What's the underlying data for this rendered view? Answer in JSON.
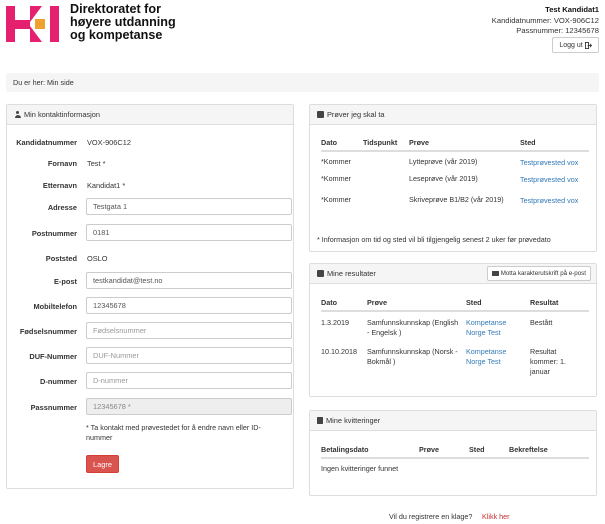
{
  "org": {
    "name_line1": "Direktoratet for",
    "name_line2": "høyere utdanning",
    "name_line3": "og kompetanse"
  },
  "user": {
    "name": "Test Kandidat1",
    "candidate_number": "Kandidatnummer: VOX-906C12",
    "passport_number": "Passnummer: 12345678",
    "logout_label": "Logg ut",
    "logout_icon": "sign-out-icon"
  },
  "breadcrumb": "Du er her: Min side",
  "contact": {
    "heading": "Min kontaktinformasjon",
    "labels": {
      "candidate": "Kandidatnummer",
      "firstname": "Fornavn",
      "lastname": "Etternavn",
      "address": "Adresse",
      "postcode": "Postnummer",
      "city": "Poststed",
      "email": "E-post",
      "mobile": "Mobiltelefon",
      "birth": "Fødselsnummer",
      "duf": "DUF-Nummer",
      "dnum": "D-nummer",
      "passport": "Passnummer"
    },
    "values": {
      "candidate": "VOX-906C12",
      "firstname": "Test *",
      "lastname": "Kandidat1 *",
      "address": "Testgata 1",
      "postcode": "0181",
      "city": "OSLO",
      "email": "testkandidat@test.no",
      "mobile": "12345678",
      "passport": "12345678 *"
    },
    "placeholders": {
      "birth": "Fødselsnummer",
      "duf": "DUF-Nummer",
      "dnum": "D-nummer"
    },
    "note": "* Ta kontakt med prøvestedet for å endre navn eller ID-nummer",
    "save_label": "Lagre"
  },
  "tests": {
    "heading": "Prøver jeg skal ta",
    "columns": [
      "Dato",
      "Tidspunkt",
      "Prøve",
      "Sted"
    ],
    "rows": [
      {
        "date": "*Kommer",
        "time": "",
        "test": "Lytteprøve (vår 2019)",
        "place": "Testprøvested vox"
      },
      {
        "date": "*Kommer",
        "time": "",
        "test": "Leseprøve (vår 2019)",
        "place": "Testprøvested vox"
      },
      {
        "date": "*Kommer",
        "time": "",
        "test": "Skriveprøve B1/B2 (vår 2019)",
        "place": "Testprøvested vox"
      }
    ],
    "note": "* Informasjon om tid og sted vil bli tilgjengelig senest 2 uker før prøvedato"
  },
  "results": {
    "heading": "Mine resultater",
    "mail_button": "Motta karakterutskrift på e-post",
    "columns": [
      "Dato",
      "Prøve",
      "Sted",
      "Resultat"
    ],
    "rows": [
      {
        "date": "1.3.2019",
        "test": "Samfunnskunnskap (English - Engelsk )",
        "place": "Kompetanse Norge Test",
        "result": "Bestått"
      },
      {
        "date": "10.10.2018",
        "test": "Samfunnskunnskap (Norsk - Bokmål )",
        "place": "Kompetanse Norge Test",
        "result": "Resultat kommer: 1. januar"
      }
    ]
  },
  "receipts": {
    "heading": "Mine kvitteringer",
    "columns": [
      "Betalingsdato",
      "Prøve",
      "Sted",
      "Bekreftelse"
    ],
    "empty": "Ingen kvitteringer funnet"
  },
  "footer": {
    "question": "Vil du registrere en klage?",
    "link": "Klikk her"
  },
  "colors": {
    "logo_pink": "#e5206f",
    "logo_orange": "#f0a030",
    "danger": "#d9534f",
    "link": "#337ab7"
  }
}
